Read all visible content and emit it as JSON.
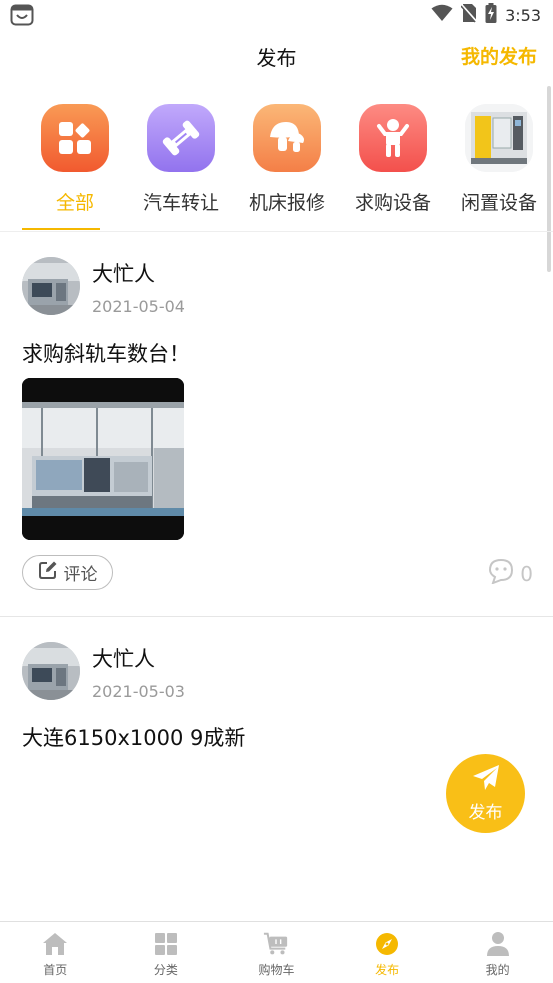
{
  "status_bar": {
    "time": "3:53",
    "icons": [
      "wifi-icon",
      "no-sim-icon",
      "battery-charging-icon"
    ],
    "app_icon": "shopping-bag-icon"
  },
  "header": {
    "title": "发布",
    "action": "我的发布"
  },
  "categories": [
    {
      "label": "全部",
      "icon": "grid-icon",
      "active": true
    },
    {
      "label": "汽车转让",
      "icon": "bone-icon",
      "active": false
    },
    {
      "label": "机床报修",
      "icon": "mushroom-icon",
      "active": false
    },
    {
      "label": "求购设备",
      "icon": "person-icon",
      "active": false
    },
    {
      "label": "闲置设备",
      "icon": "machine-photo",
      "active": false
    }
  ],
  "posts": [
    {
      "author": "大忙人",
      "date": "2021-05-04",
      "text": "求购斜轨车数台！",
      "comment_label": "评论",
      "comment_count": "0"
    },
    {
      "author": "大忙人",
      "date": "2021-05-03",
      "text": "大连6150x1000 9成新"
    }
  ],
  "fab": {
    "label": "发布",
    "icon": "paper-plane-icon"
  },
  "bottom_nav": [
    {
      "label": "首页",
      "icon": "home-icon",
      "active": false
    },
    {
      "label": "分类",
      "icon": "grid-icon",
      "active": false
    },
    {
      "label": "购物车",
      "icon": "cart-icon",
      "active": false
    },
    {
      "label": "发布",
      "icon": "compass-icon",
      "active": true
    },
    {
      "label": "我的",
      "icon": "user-icon",
      "active": false
    }
  ],
  "colors": {
    "accent": "#f5b800",
    "fab": "#f9bf17",
    "cat_all": "#f5683a",
    "cat_car": "#a084f5",
    "cat_repair": "#f8a05a",
    "cat_buy": "#f86b66"
  }
}
